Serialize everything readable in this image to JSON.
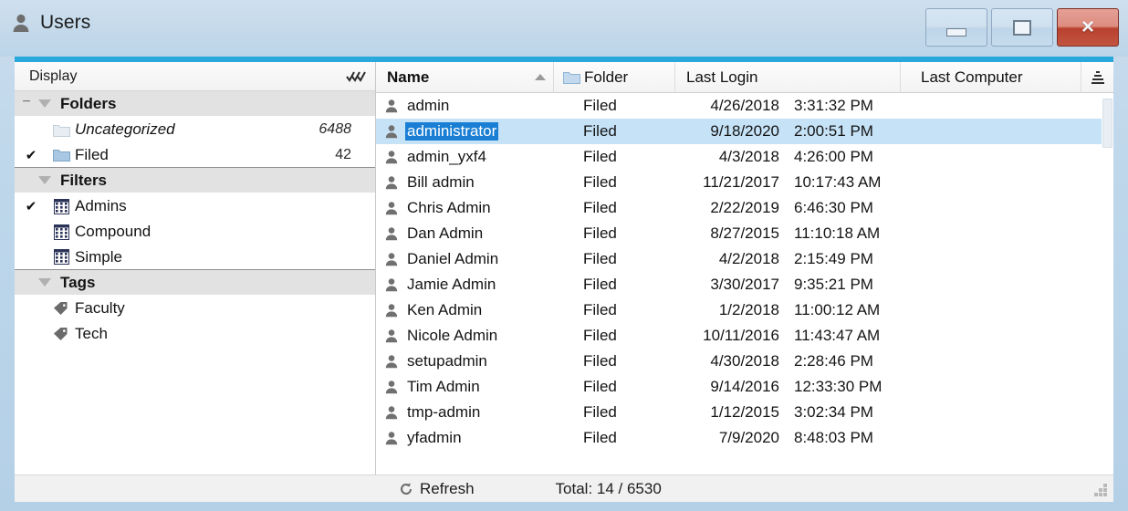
{
  "window": {
    "title": "Users",
    "title_icon": "user-icon",
    "controls": {
      "minimize": "minimize-icon",
      "maximize": "maximize-icon",
      "close": "×"
    },
    "accent_color": "#29a8dc"
  },
  "sidebar": {
    "header": {
      "label": "Display",
      "icon": "checkmarks-icon"
    },
    "groups": [
      {
        "label": "Folders",
        "expander": "−",
        "items": [
          {
            "checked": "",
            "icon": "folder-icon-pale",
            "label": "Uncategorized",
            "count": "6488",
            "italic": true
          },
          {
            "checked": "✔",
            "icon": "folder-icon",
            "label": "Filed",
            "count": "42",
            "italic": false
          }
        ]
      },
      {
        "label": "Filters",
        "expander": "",
        "items": [
          {
            "checked": "✔",
            "icon": "grid-icon",
            "label": "Admins",
            "count": "",
            "italic": false
          },
          {
            "checked": "",
            "icon": "grid-icon",
            "label": "Compound",
            "count": "",
            "italic": false
          },
          {
            "checked": "",
            "icon": "grid-icon",
            "label": "Simple",
            "count": "",
            "italic": false
          }
        ]
      },
      {
        "label": "Tags",
        "expander": "",
        "items": [
          {
            "checked": "",
            "icon": "tag-icon",
            "label": "Faculty",
            "count": "",
            "italic": false
          },
          {
            "checked": "",
            "icon": "tag-icon",
            "label": "Tech",
            "count": "",
            "italic": false
          }
        ]
      }
    ]
  },
  "table": {
    "columns": [
      {
        "key": "name",
        "label": "Name",
        "sort": "asc"
      },
      {
        "key": "folder",
        "label": "Folder",
        "icon": "folder-icon"
      },
      {
        "key": "last_login",
        "label": "Last Login"
      },
      {
        "key": "last_computer",
        "label": "Last Computer"
      },
      {
        "key": "tail",
        "label": "",
        "icon": "column-chooser-icon"
      }
    ],
    "rows": [
      {
        "name": "admin",
        "folder": "Filed",
        "date": "4/26/2018",
        "time": "3:31:32 PM",
        "computer": "",
        "selected": false
      },
      {
        "name": "administrator",
        "folder": "Filed",
        "date": "9/18/2020",
        "time": "2:00:51 PM",
        "computer": "",
        "selected": true
      },
      {
        "name": "admin_yxf4",
        "folder": "Filed",
        "date": "4/3/2018",
        "time": "4:26:00 PM",
        "computer": "",
        "selected": false
      },
      {
        "name": "Bill admin",
        "folder": "Filed",
        "date": "11/21/2017",
        "time": "10:17:43 AM",
        "computer": "",
        "selected": false
      },
      {
        "name": "Chris Admin",
        "folder": "Filed",
        "date": "2/22/2019",
        "time": "6:46:30 PM",
        "computer": "",
        "selected": false
      },
      {
        "name": "Dan Admin",
        "folder": "Filed",
        "date": "8/27/2015",
        "time": "11:10:18 AM",
        "computer": "",
        "selected": false
      },
      {
        "name": "Daniel Admin",
        "folder": "Filed",
        "date": "4/2/2018",
        "time": "2:15:49 PM",
        "computer": "",
        "selected": false
      },
      {
        "name": "Jamie Admin",
        "folder": "Filed",
        "date": "3/30/2017",
        "time": "9:35:21 PM",
        "computer": "",
        "selected": false
      },
      {
        "name": "Ken Admin",
        "folder": "Filed",
        "date": "1/2/2018",
        "time": "11:00:12 AM",
        "computer": "",
        "selected": false
      },
      {
        "name": "Nicole Admin",
        "folder": "Filed",
        "date": "10/11/2016",
        "time": "11:43:47 AM",
        "computer": "",
        "selected": false
      },
      {
        "name": "setupadmin",
        "folder": "Filed",
        "date": "4/30/2018",
        "time": "2:28:46 PM",
        "computer": "",
        "selected": false
      },
      {
        "name": "Tim Admin",
        "folder": "Filed",
        "date": "9/14/2016",
        "time": "12:33:30 PM",
        "computer": "",
        "selected": false
      },
      {
        "name": "tmp-admin",
        "folder": "Filed",
        "date": "1/12/2015",
        "time": "3:02:34 PM",
        "computer": "",
        "selected": false
      },
      {
        "name": "yfadmin",
        "folder": "Filed",
        "date": "7/9/2020",
        "time": "8:48:03 PM",
        "computer": "",
        "selected": false
      }
    ]
  },
  "statusbar": {
    "refresh_label": "Refresh",
    "refresh_icon": "refresh-icon",
    "total_label": "Total: 14 / 6530"
  }
}
